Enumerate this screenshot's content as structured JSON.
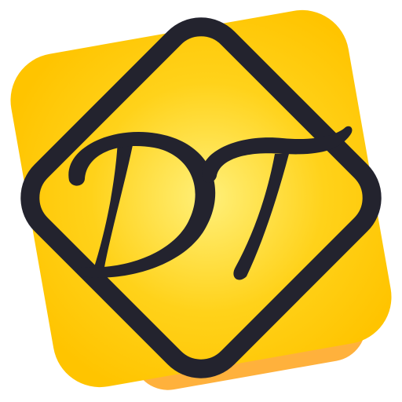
{
  "logo": {
    "monogram": "DT",
    "colors": {
      "tile_light": "#FFF07A",
      "tile_mid": "#FFD21A",
      "tile_dark": "#FFC400",
      "tile_shadow": "#FFB13C",
      "outline": "#23232E",
      "letters": "#23232E",
      "background": "#FFFFFF"
    },
    "icons": [
      "square-tile-icon",
      "rotated-frame-icon",
      "dt-monogram-icon"
    ]
  }
}
